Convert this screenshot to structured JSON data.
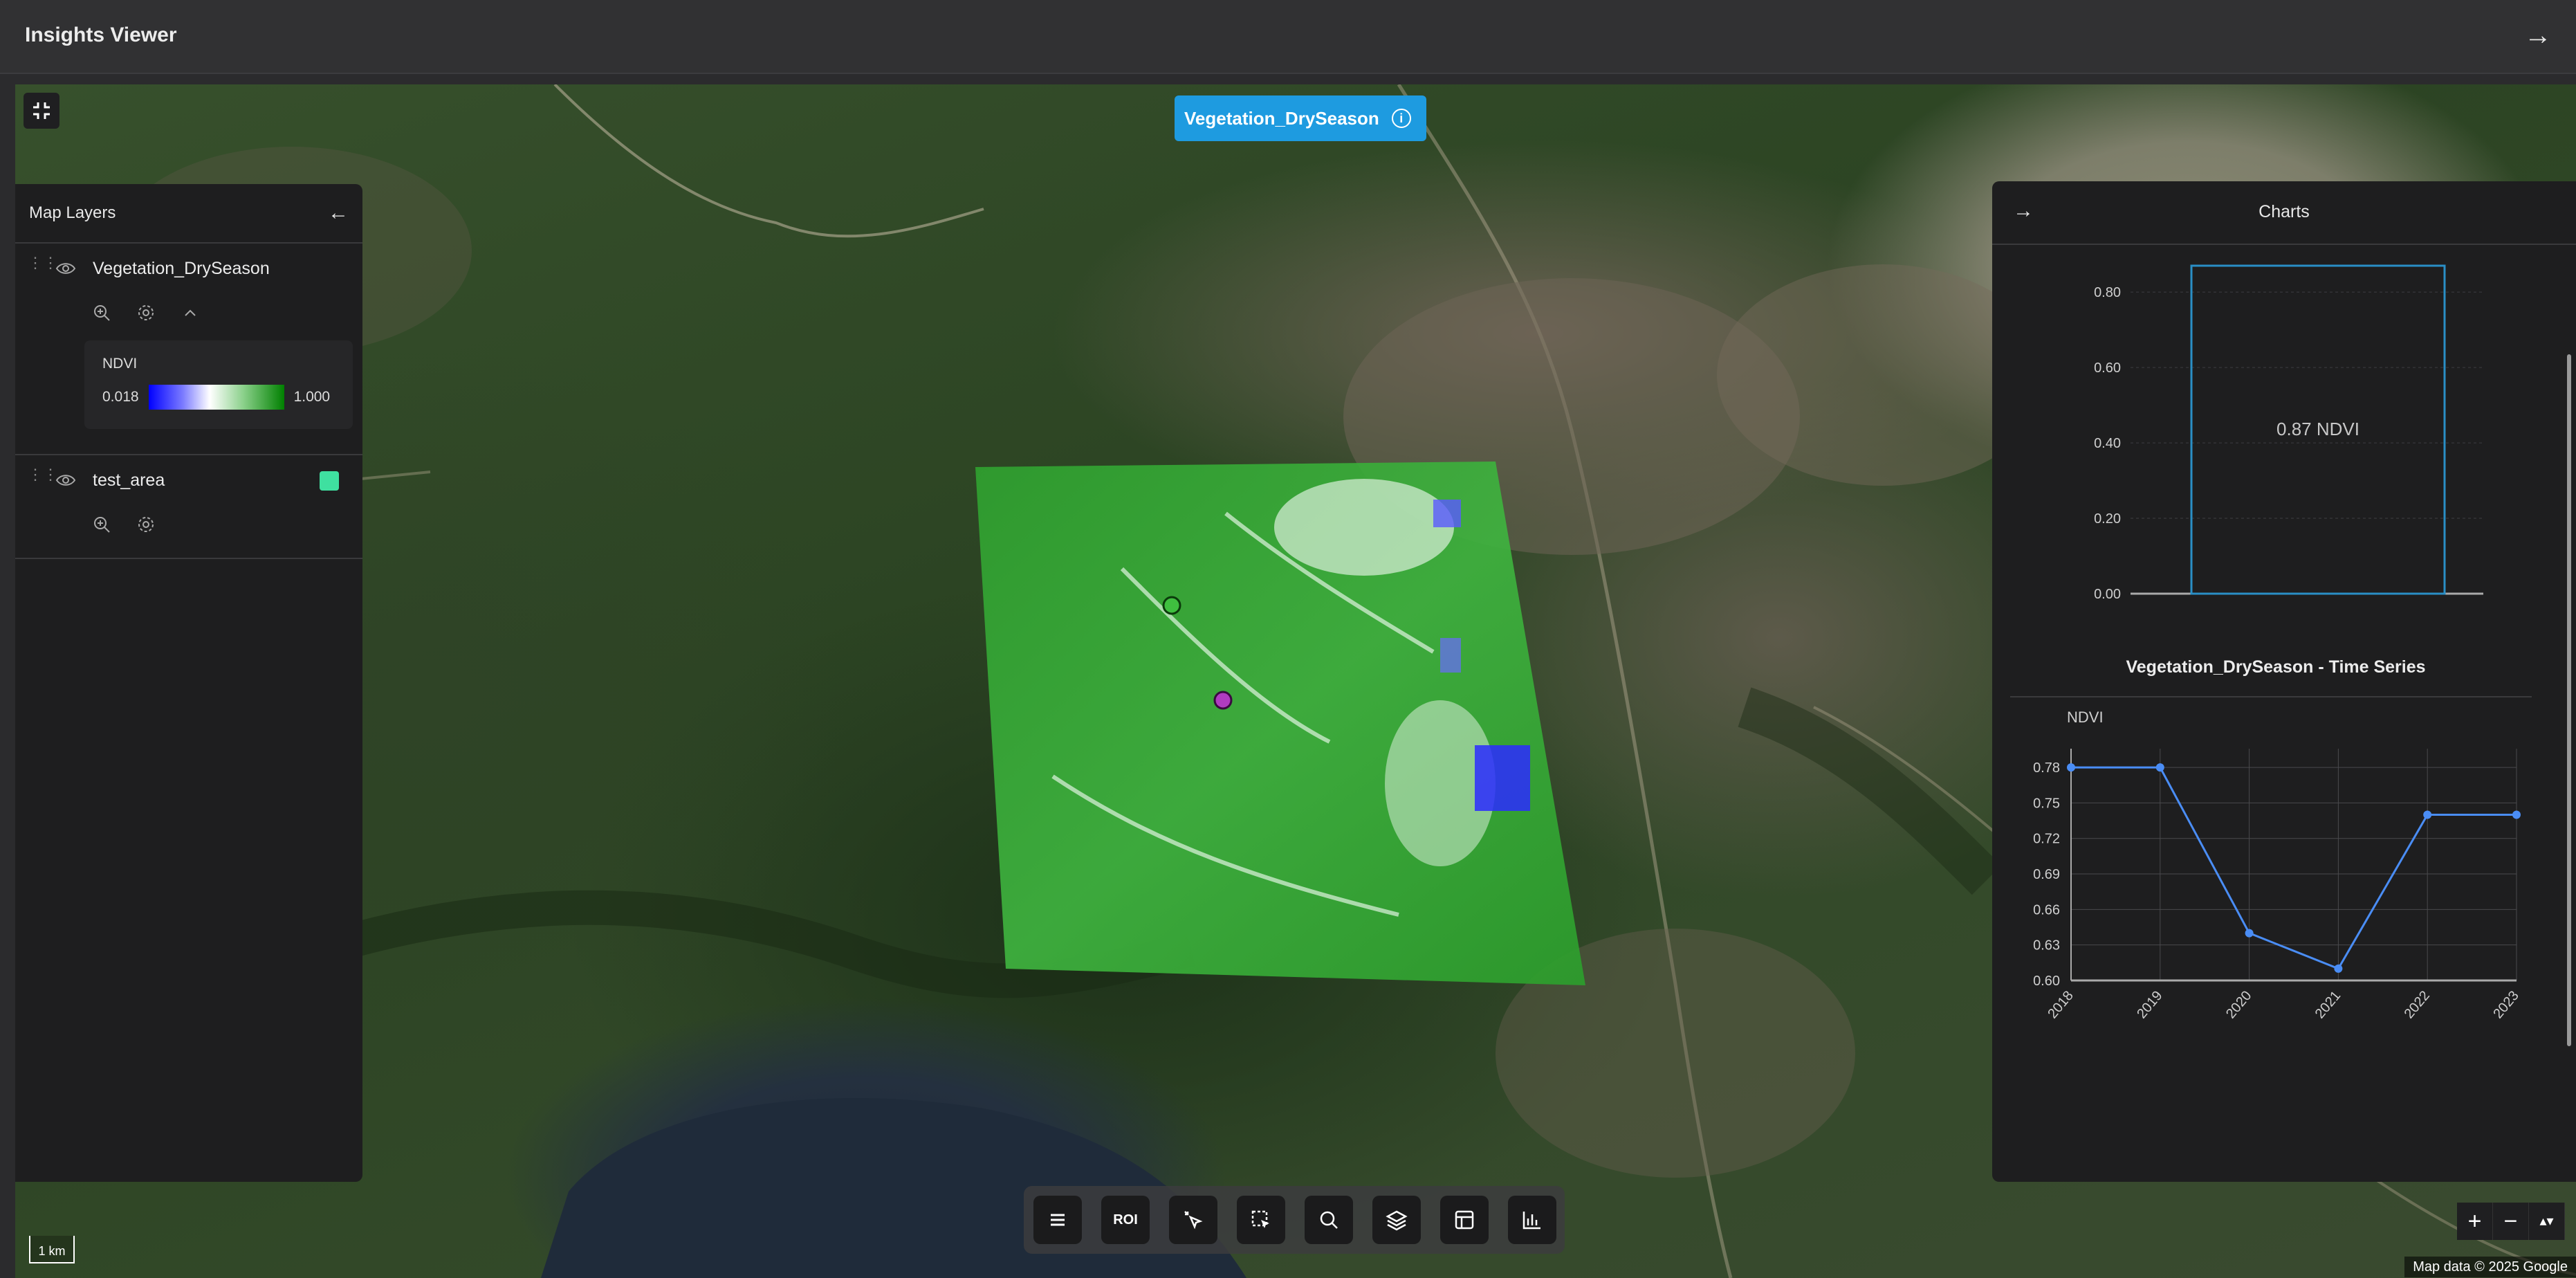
{
  "app": {
    "title": "Insights Viewer"
  },
  "map": {
    "active_layer_badge": "Vegetation_DrySeason",
    "attribution": "Map data © 2025 Google",
    "scale_label": "1 km",
    "zoom_in": "+",
    "zoom_out": "−",
    "compass": "▴▾"
  },
  "left_panel": {
    "title": "Map Layers",
    "layers": [
      {
        "name": "Vegetation_DrySeason",
        "legend": {
          "title": "NDVI",
          "min": "0.018",
          "max": "1.000"
        }
      },
      {
        "name": "test_area",
        "swatch_color": "#3fe0a0"
      }
    ]
  },
  "right_panel": {
    "title": "Charts"
  },
  "toolbar": {
    "roi_label": "ROI",
    "icons": [
      "menu-icon",
      "roi-icon",
      "pointer-sparkle-icon",
      "select-box-icon",
      "search-icon",
      "layers-icon",
      "table-icon",
      "bar-chart-icon"
    ]
  },
  "colors": {
    "accent": "#1e9be0",
    "ndvi_low": "#0000ff",
    "ndvi_high": "#008000",
    "series": "#4a8df5",
    "bar_outline": "#2a8fc6"
  },
  "chart_data": [
    {
      "type": "bar",
      "categories": [
        ""
      ],
      "values": [
        0.87
      ],
      "data_label": "0.87 NDVI",
      "yticks": [
        "0.00",
        "0.20",
        "0.40",
        "0.60",
        "0.80"
      ],
      "ylim": [
        0,
        0.87
      ]
    },
    {
      "type": "line",
      "title": "Vegetation_DrySeason - Time Series",
      "ylabel": "NDVI",
      "x": [
        "2018",
        "2019",
        "2020",
        "2021",
        "2022",
        "2023"
      ],
      "values": [
        0.78,
        0.78,
        0.64,
        0.61,
        0.74,
        0.74
      ],
      "yticks": [
        "0.60",
        "0.63",
        "0.66",
        "0.69",
        "0.72",
        "0.75",
        "0.78"
      ],
      "ylim": [
        0.6,
        0.79
      ]
    }
  ]
}
